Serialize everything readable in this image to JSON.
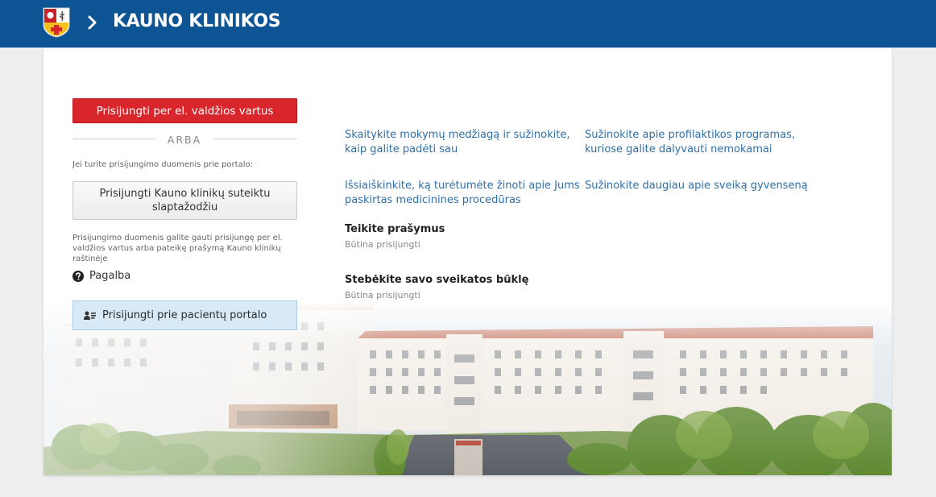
{
  "header": {
    "title": "KAUNO KLINIKOS"
  },
  "login": {
    "gov_button": "Prisijungti per el. valdžios vartus",
    "or_text": "ARBA",
    "credentials_note": "Jei turite prisijungimo duomenis prie portalo:",
    "password_button_line1": "Prisijungti Kauno klinikų suteiktu",
    "password_button_line2": "slaptažodžiu",
    "info_line1": "Prisijungimo duomenis galite gauti prisijungę per el.",
    "info_line2": "valdžios vartus arba pateikę prašymą Kauno klinikų",
    "info_line3": "raštinėje",
    "help_label": "Pagalba",
    "patient_portal_button": "Prisijungti prie pacientų portalo"
  },
  "links": [
    {
      "line1": "Skaitykite mokymų medžiagą ir sužinokite,",
      "line2": "kaip galite padėti sau"
    },
    {
      "line1": "Sužinokite apie profilaktikos programas,",
      "line2": "kuriose galite dalyvauti nemokamai"
    },
    {
      "line1": "Išsiaiškinkite, ką turėtumėte žinoti apie Jums",
      "line2": "paskirtas medicinines procedūras"
    },
    {
      "line1": "Sužinokite daugiau apie sveiką gyvenseną",
      "line2": ""
    }
  ],
  "features": [
    {
      "title": "Teikite prašymus",
      "subtitle": "Būtina prisijungti"
    },
    {
      "title": "Stebėkite savo sveikatos būklę",
      "subtitle": "Būtina prisijungti"
    }
  ],
  "colors": {
    "header_bg": "#0d5495",
    "gov_button_bg": "#d9262c",
    "link": "#2f6fa8",
    "patient_button_bg": "#d8eaf8"
  },
  "icons": {
    "logo": "coat-of-arms-icon",
    "breadcrumb": "chevron-right-icon",
    "help": "question-circle-icon",
    "patient": "user-id-icon"
  }
}
